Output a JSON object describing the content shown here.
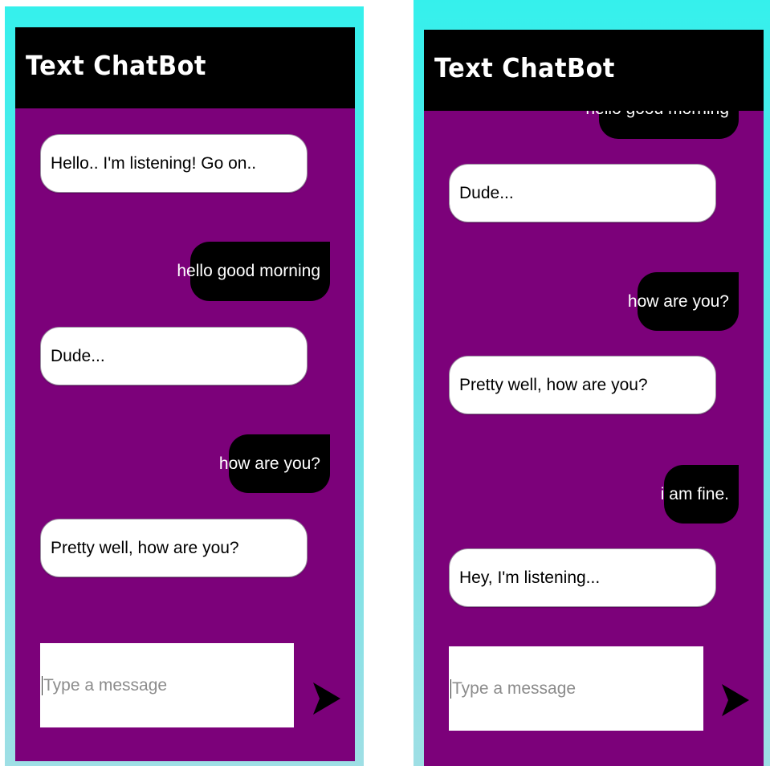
{
  "app": {
    "title": "Text ChatBot",
    "colors": {
      "background": "#7c017a",
      "header": "#000000",
      "bot_bubble": "#ffffff",
      "user_bubble": "#000000",
      "frame_border": "#35f0ec"
    },
    "send_icon": "send-arrow-icon"
  },
  "left": {
    "messages": [
      {
        "sender": "bot",
        "text": "Hello.. I'm listening! Go on.."
      },
      {
        "sender": "user",
        "text": "hello good morning"
      },
      {
        "sender": "bot",
        "text": "Dude..."
      },
      {
        "sender": "user",
        "text": "how are you?"
      },
      {
        "sender": "bot",
        "text": "Pretty well, how are you?"
      }
    ],
    "input_placeholder": "Type a message"
  },
  "right": {
    "messages": [
      {
        "sender": "user",
        "text": "hello good morning"
      },
      {
        "sender": "bot",
        "text": "Dude..."
      },
      {
        "sender": "user",
        "text": "how are you?"
      },
      {
        "sender": "bot",
        "text": "Pretty well, how are you?"
      },
      {
        "sender": "user",
        "text": "i am fine."
      },
      {
        "sender": "bot",
        "text": "Hey, I'm listening..."
      }
    ],
    "input_placeholder": "Type a message"
  }
}
